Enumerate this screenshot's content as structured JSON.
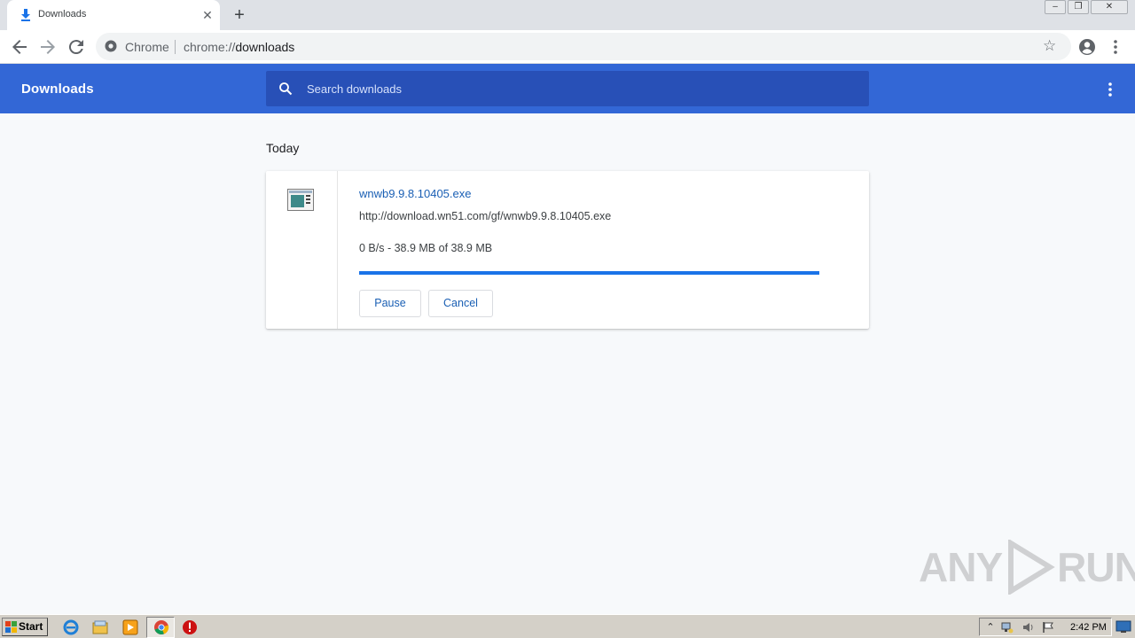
{
  "browser": {
    "tab": {
      "title": "Downloads",
      "icon": "download-icon"
    },
    "omnibox": {
      "site_label": "Chrome",
      "url_scheme": "chrome://",
      "url_host": "downloads"
    }
  },
  "page": {
    "header_title": "Downloads",
    "search_placeholder": "Search downloads",
    "section_date": "Today",
    "download": {
      "file_name": "wnwb9.9.8.10405.exe",
      "url": "http://download.wn51.com/gf/wnwb9.9.8.10405.exe",
      "status": "0 B/s - 38.9 MB of 38.9 MB",
      "progress_fraction": 1.0,
      "pause_label": "Pause",
      "cancel_label": "Cancel"
    }
  },
  "watermark": {
    "left": "ANY",
    "right": "RUN"
  },
  "taskbar": {
    "start_label": "Start",
    "clock": "2:42 PM"
  },
  "colors": {
    "header_blue": "#3367d6",
    "search_blue": "#2850b7",
    "link_blue": "#1a5fb4",
    "progress_blue": "#1a73e8"
  }
}
